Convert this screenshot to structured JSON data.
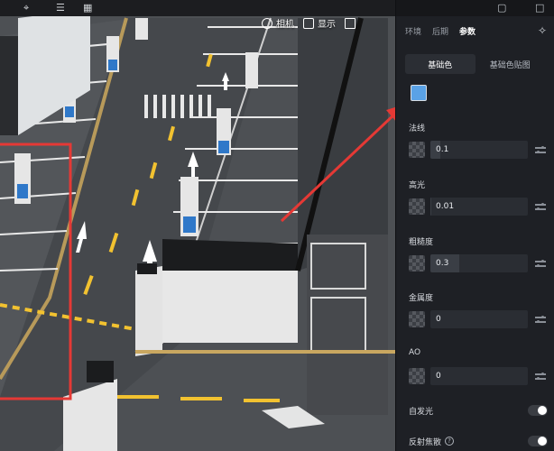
{
  "viewport": {
    "toolbar": [
      {
        "label": "相机",
        "icon": "camera-icon"
      },
      {
        "label": "显示",
        "icon": "display-icon"
      },
      {
        "label": "",
        "icon": "layers-icon"
      }
    ],
    "scene_description_icons": [
      "parking-lot-scene"
    ]
  },
  "panel": {
    "tabs": [
      {
        "label": "环境",
        "active": false
      },
      {
        "label": "后期",
        "active": false
      },
      {
        "label": "参数",
        "active": true
      }
    ],
    "subtabs": [
      {
        "label": "基础色",
        "active": true
      },
      {
        "label": "基础色贴图",
        "active": false
      }
    ],
    "base_color": "#5aa2e6",
    "properties": [
      {
        "label": "法线",
        "value": "0.1",
        "fill": 0.1
      },
      {
        "label": "高光",
        "value": "0.01",
        "fill": 0.01
      },
      {
        "label": "粗糙度",
        "value": "0.3",
        "fill": 0.3
      },
      {
        "label": "金属度",
        "value": "0",
        "fill": 0
      },
      {
        "label": "AO",
        "value": "0",
        "fill": 0
      }
    ],
    "toggles": [
      {
        "label": "自发光",
        "on": false,
        "help": false
      },
      {
        "label": "反射焦散",
        "on": false,
        "help": true
      }
    ]
  },
  "colors": {
    "highlight": "#e53935",
    "panel_bg": "#1e2025",
    "road": "#4a4d51",
    "lane_yellow": "#f2c230"
  }
}
